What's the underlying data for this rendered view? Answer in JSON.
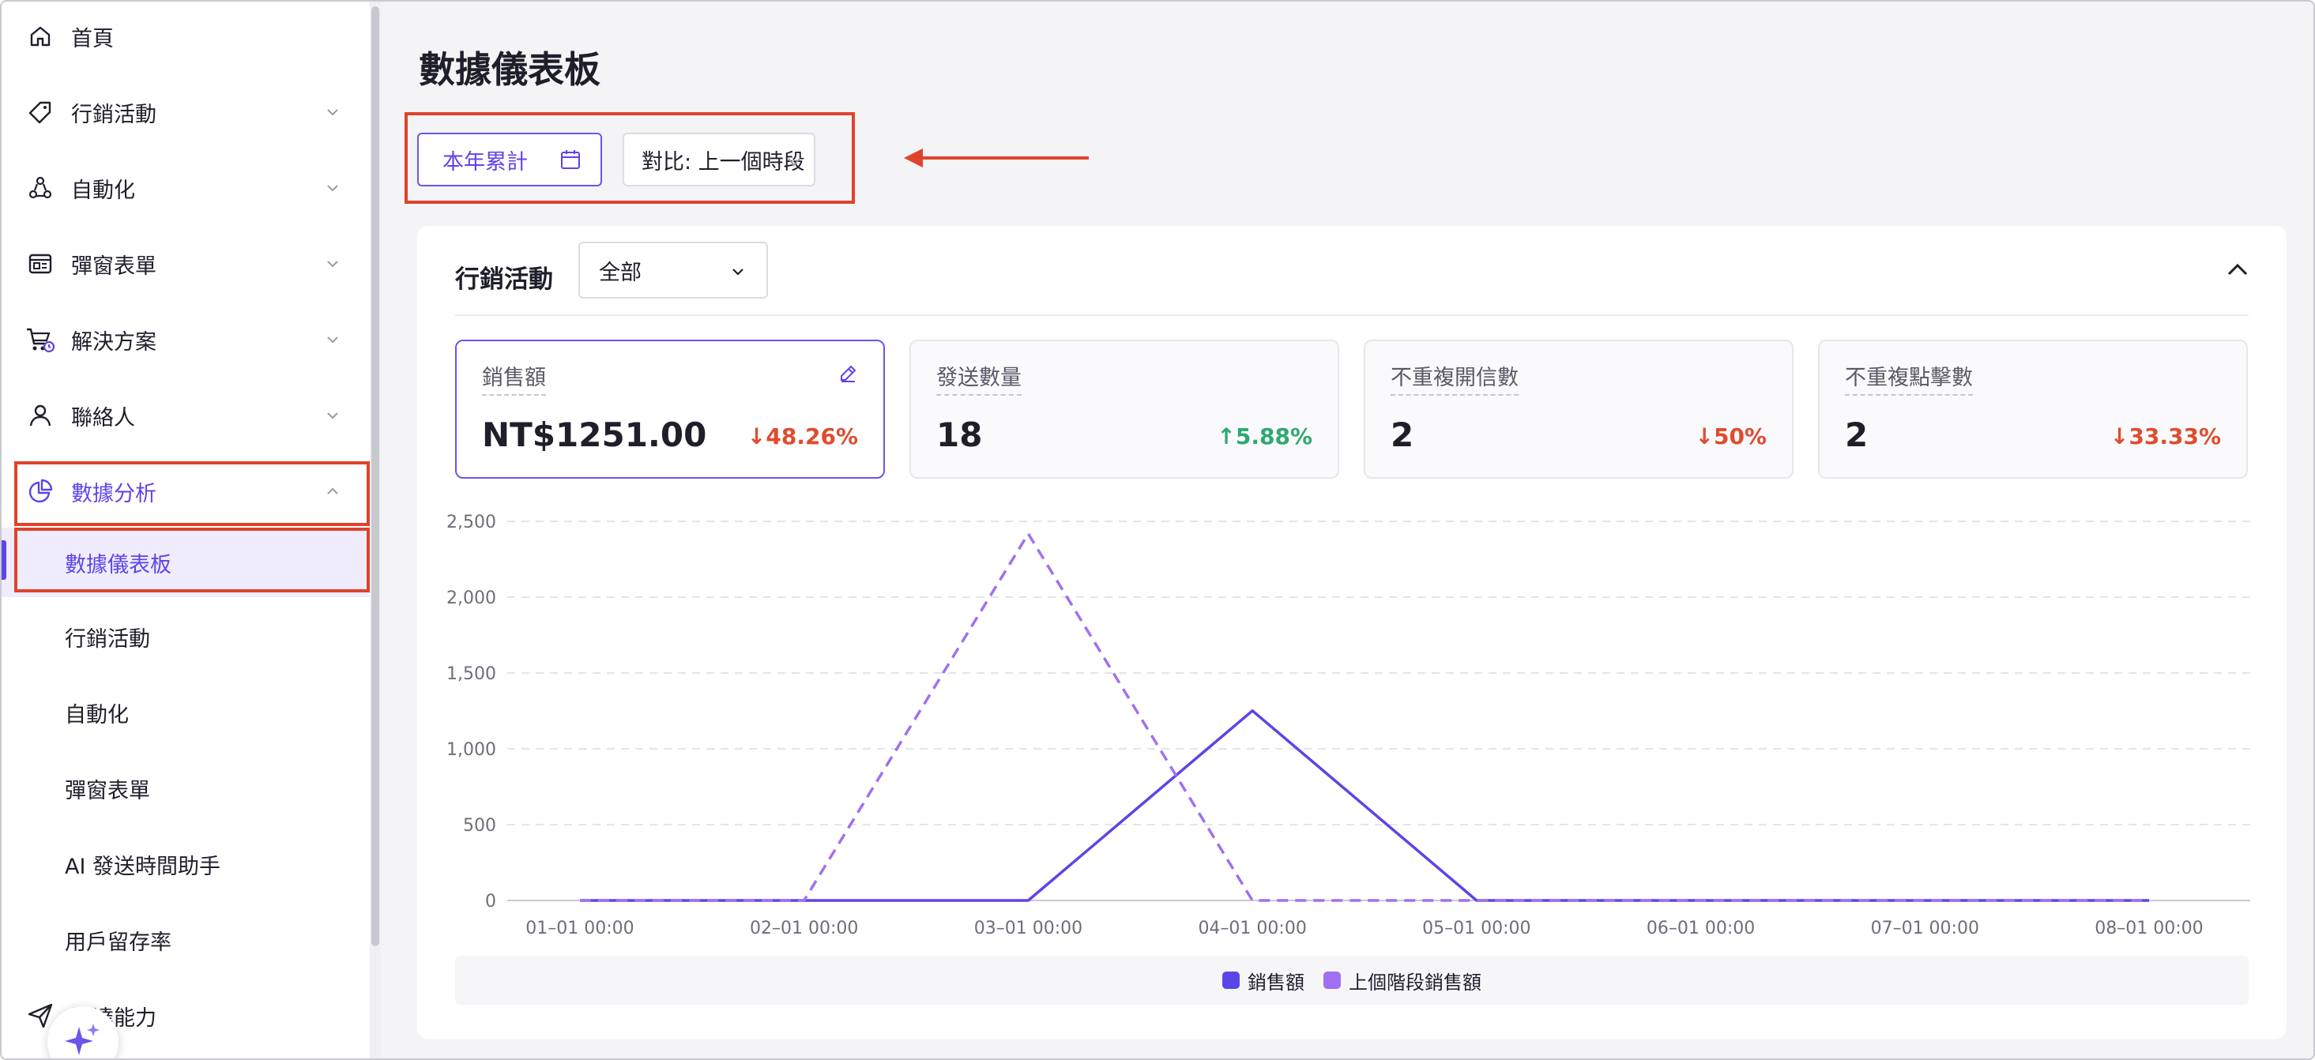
{
  "sidebar": {
    "items": [
      {
        "label": "首頁",
        "icon": "home-icon"
      },
      {
        "label": "行銷活動",
        "icon": "tag-icon"
      },
      {
        "label": "自動化",
        "icon": "automation-icon"
      },
      {
        "label": "彈窗表單",
        "icon": "form-icon"
      },
      {
        "label": "解決方案",
        "icon": "cart-icon"
      },
      {
        "label": "聯絡人",
        "icon": "person-icon"
      },
      {
        "label": "數據分析",
        "icon": "pie-chart-icon"
      }
    ],
    "sub_items": [
      {
        "label": "數據儀表板"
      },
      {
        "label": "行銷活動"
      },
      {
        "label": "自動化"
      },
      {
        "label": "彈窗表單"
      },
      {
        "label": "AI 發送時間助手"
      },
      {
        "label": "用戶留存率"
      }
    ],
    "bottom_item": {
      "label": "送達能力",
      "icon": "send-icon"
    }
  },
  "header": {
    "title": "數據儀表板",
    "date_range_label": "本年累計",
    "compare_label": "對比: 上一個時段"
  },
  "card": {
    "title": "行銷活動",
    "filter_value": "全部",
    "metrics": [
      {
        "label": "銷售額",
        "value": "NT$1251.00",
        "change": "48.26%",
        "direction": "down"
      },
      {
        "label": "發送數量",
        "value": "18",
        "change": "5.88%",
        "direction": "up"
      },
      {
        "label": "不重複開信數",
        "value": "2",
        "change": "50%",
        "direction": "down"
      },
      {
        "label": "不重複點擊數",
        "value": "2",
        "change": "33.33%",
        "direction": "down"
      }
    ]
  },
  "colors": {
    "accent": "#5b45e8",
    "highlight": "#e0422c",
    "down": "#e04b2e",
    "up": "#2fa870"
  },
  "chart_data": {
    "type": "line",
    "x": [
      "01–01 00:00",
      "02–01 00:00",
      "03–01 00:00",
      "04–01 00:00",
      "05–01 00:00",
      "06–01 00:00",
      "07–01 00:00",
      "08–01 00:00"
    ],
    "y_ticks": [
      "0",
      "500",
      "1,000",
      "1,500",
      "2,000",
      "2,500"
    ],
    "ylim": [
      0,
      2500
    ],
    "grid": true,
    "legend": "bottom",
    "series": [
      {
        "name": "銷售額",
        "color": "#5b45e8",
        "dashed": false,
        "values": [
          0,
          0,
          0,
          1251,
          0,
          0,
          0,
          0
        ]
      },
      {
        "name": "上個階段銷售額",
        "color": "#a070f0",
        "dashed": true,
        "values": [
          0,
          0,
          2418,
          0,
          0,
          0,
          0,
          0
        ]
      }
    ]
  }
}
